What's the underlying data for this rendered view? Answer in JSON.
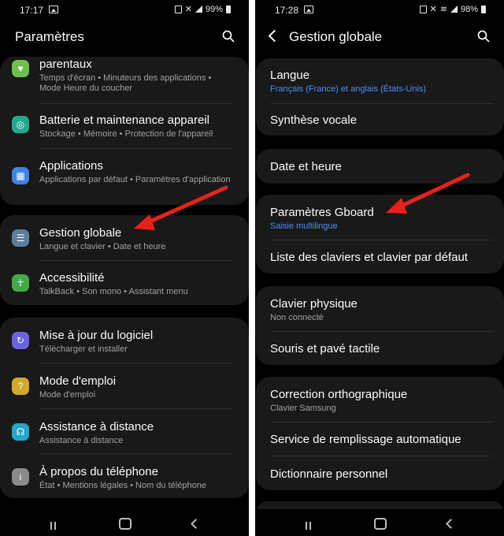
{
  "left": {
    "status": {
      "time": "17:17",
      "battery": "99%"
    },
    "header": {
      "title": "Paramètres"
    },
    "rows": [
      {
        "label": "parentaux",
        "sub": "Temps d'écran  •  Minuteurs des applications  •  Mode Heure du coucher",
        "icon": "heart-circle-icon",
        "color": "#6fbf4a"
      },
      {
        "label": "Batterie et maintenance appareil",
        "sub": "Stockage  •  Mémoire  •  Protection de l'appareil",
        "icon": "battery-care-icon",
        "color": "#25a98e"
      },
      {
        "label": "Applications",
        "sub": "Applications par défaut  •  Paramètres d'application",
        "icon": "apps-grid-icon",
        "color": "#3f83e6"
      },
      {
        "label": "Gestion globale",
        "sub": "Langue et clavier  •  Date et heure",
        "icon": "sliders-icon",
        "color": "#5d7d9b"
      },
      {
        "label": "Accessibilité",
        "sub": "TalkBack  •  Son mono  •  Assistant menu",
        "icon": "accessibility-icon",
        "color": "#43a94a"
      },
      {
        "label": "Mise à jour du logiciel",
        "sub": "Télécharger et installer",
        "icon": "software-update-icon",
        "color": "#6b63e0"
      },
      {
        "label": "Mode d'emploi",
        "sub": "Mode d'emploi",
        "icon": "user-manual-icon",
        "color": "#d4a72c"
      },
      {
        "label": "Assistance à distance",
        "sub": "Assistance à distance",
        "icon": "headset-icon",
        "color": "#22a9c9"
      },
      {
        "label": "À propos du téléphone",
        "sub": "État  •  Mentions légales  •  Nom du téléphone",
        "icon": "info-icon",
        "color": "#8a8a8a"
      }
    ]
  },
  "right": {
    "status": {
      "time": "17:28",
      "battery": "98%"
    },
    "header": {
      "title": "Gestion globale"
    },
    "rows": [
      {
        "label": "Langue",
        "sub": "Français (France) et anglais (États-Unis)"
      },
      {
        "label": "Synthèse vocale",
        "sub": ""
      },
      {
        "label": "Date et heure",
        "sub": ""
      },
      {
        "label": "Paramètres Gboard",
        "sub": "Saisie multilingue"
      },
      {
        "label": "Liste des claviers et clavier par défaut",
        "sub": ""
      },
      {
        "label": "Clavier physique",
        "sub": "Non connecté"
      },
      {
        "label": "Souris et pavé tactile",
        "sub": ""
      },
      {
        "label": "Correction orthographique",
        "sub": "Clavier Samsung"
      },
      {
        "label": "Service de remplissage automatique",
        "sub": ""
      },
      {
        "label": "Dictionnaire personnel",
        "sub": ""
      }
    ]
  },
  "colors": {
    "background": "#000000",
    "card": "#191919",
    "accent_blue": "#4e8cf6",
    "annotation_arrow": "#e8221b"
  }
}
